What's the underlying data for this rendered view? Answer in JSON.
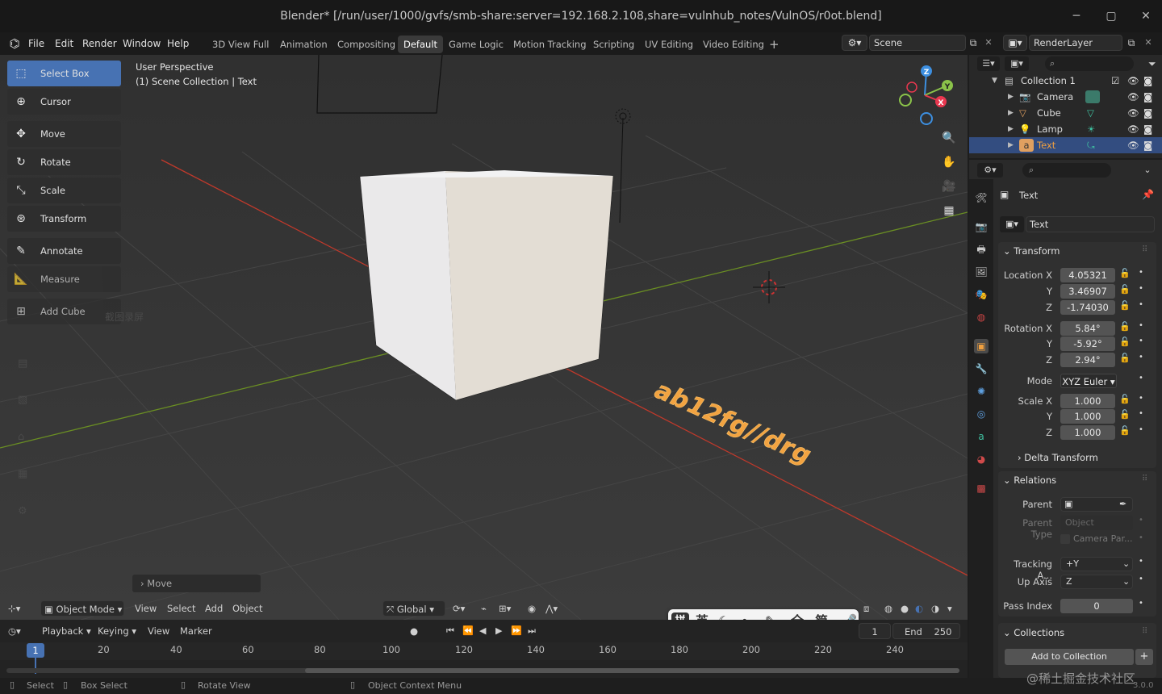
{
  "window": {
    "title": "Blender* [/run/user/1000/gvfs/smb-share:server=192.168.2.108,share=vulnhub_notes/VulnOS/r0ot.blend]",
    "minimize_icon": "minimize-icon",
    "maximize_icon": "maximize-icon",
    "close_icon": "close-icon"
  },
  "menubar": {
    "items": [
      "File",
      "Edit",
      "Render",
      "Window",
      "Help"
    ],
    "workspaces": [
      "3D View Full",
      "Animation",
      "Compositing",
      "Default",
      "Game Logic",
      "Motion Tracking",
      "Scripting",
      "UV Editing",
      "Video Editing"
    ],
    "active_workspace": "Default",
    "add_tab": "+",
    "scene": "Scene",
    "render_layer": "RenderLayer"
  },
  "toolbar": {
    "tools": [
      {
        "label": "Select Box",
        "icon": "select-box-icon"
      },
      {
        "label": "Cursor",
        "icon": "cursor-icon"
      },
      {
        "label": "Move",
        "icon": "move-icon"
      },
      {
        "label": "Rotate",
        "icon": "rotate-icon"
      },
      {
        "label": "Scale",
        "icon": "scale-icon"
      },
      {
        "label": "Transform",
        "icon": "transform-icon"
      },
      {
        "label": "Annotate",
        "icon": "annotate-icon"
      },
      {
        "label": "Measure",
        "icon": "measure-icon"
      },
      {
        "label": "Add Cube",
        "icon": "add-cube-icon"
      }
    ],
    "active_tool": "Select Box"
  },
  "viewport": {
    "perspective": "User Perspective",
    "collection": "(1) Scene Collection | Text",
    "text_object": "ab12fg//drg",
    "last_op": "Move",
    "gizmo": {
      "z": "Z",
      "y": "Y",
      "x": "X"
    },
    "overlay_texts": [
      "截图录屏"
    ],
    "header": {
      "mode": "Object Mode",
      "menus": [
        "View",
        "Select",
        "Add",
        "Object"
      ],
      "orientation": "Global"
    }
  },
  "ime_bar": [
    "拼",
    "英",
    "全",
    "简"
  ],
  "timeline": {
    "menus": [
      "Playback",
      "Keying",
      "View",
      "Marker"
    ],
    "current_frame": "1",
    "start": "1",
    "end_label": "End",
    "end": "250",
    "ticks": [
      "1",
      "20",
      "40",
      "60",
      "80",
      "100",
      "120",
      "140",
      "160",
      "180",
      "200",
      "220",
      "240"
    ]
  },
  "statusbar": {
    "items": [
      "Select",
      "Box Select",
      "Rotate View",
      "Object Context Menu"
    ],
    "version": "3.0.0"
  },
  "outliner": {
    "root": "Collection 1",
    "items": [
      {
        "label": "Camera",
        "icon": "camera-icon"
      },
      {
        "label": "Cube",
        "icon": "mesh-icon"
      },
      {
        "label": "Lamp",
        "icon": "lamp-icon"
      },
      {
        "label": "Text",
        "icon": "text-icon"
      }
    ],
    "selected": "Text"
  },
  "properties": {
    "object_name": "Text",
    "data_name": "Text",
    "transform_header": "Transform",
    "location_label": "Location X",
    "location": [
      "4.05321",
      "3.46907",
      "-1.74030"
    ],
    "rotation_label": "Rotation X",
    "rotation": [
      "5.84°",
      "-5.92°",
      "2.94°"
    ],
    "mode_label": "Mode",
    "mode": "XYZ Euler",
    "scale_label": "Scale X",
    "scale": [
      "1.000",
      "1.000",
      "1.000"
    ],
    "axis_y": "Y",
    "axis_z": "Z",
    "delta_transform": "Delta Transform",
    "relations_header": "Relations",
    "parent_label": "Parent",
    "parent_type_label": "Parent Type",
    "parent_type": "Object",
    "camera_parent": "Camera Par...",
    "tracking_label": "Tracking A...",
    "tracking": "+Y",
    "up_axis_label": "Up Axis",
    "up_axis": "Z",
    "pass_index_label": "Pass Index",
    "pass_index": "0",
    "collections_header": "Collections",
    "add_to_collection": "Add to Collection"
  },
  "watermark": "@稀土掘金技术社区",
  "colors": {
    "accent": "#4772b3",
    "text_object": "#f0a040",
    "axis_x": "#c0392b",
    "axis_y": "#6a8e23",
    "gizmo_x": "#e8374f",
    "gizmo_y": "#8bc34a",
    "gizmo_z": "#3d8fe0"
  }
}
